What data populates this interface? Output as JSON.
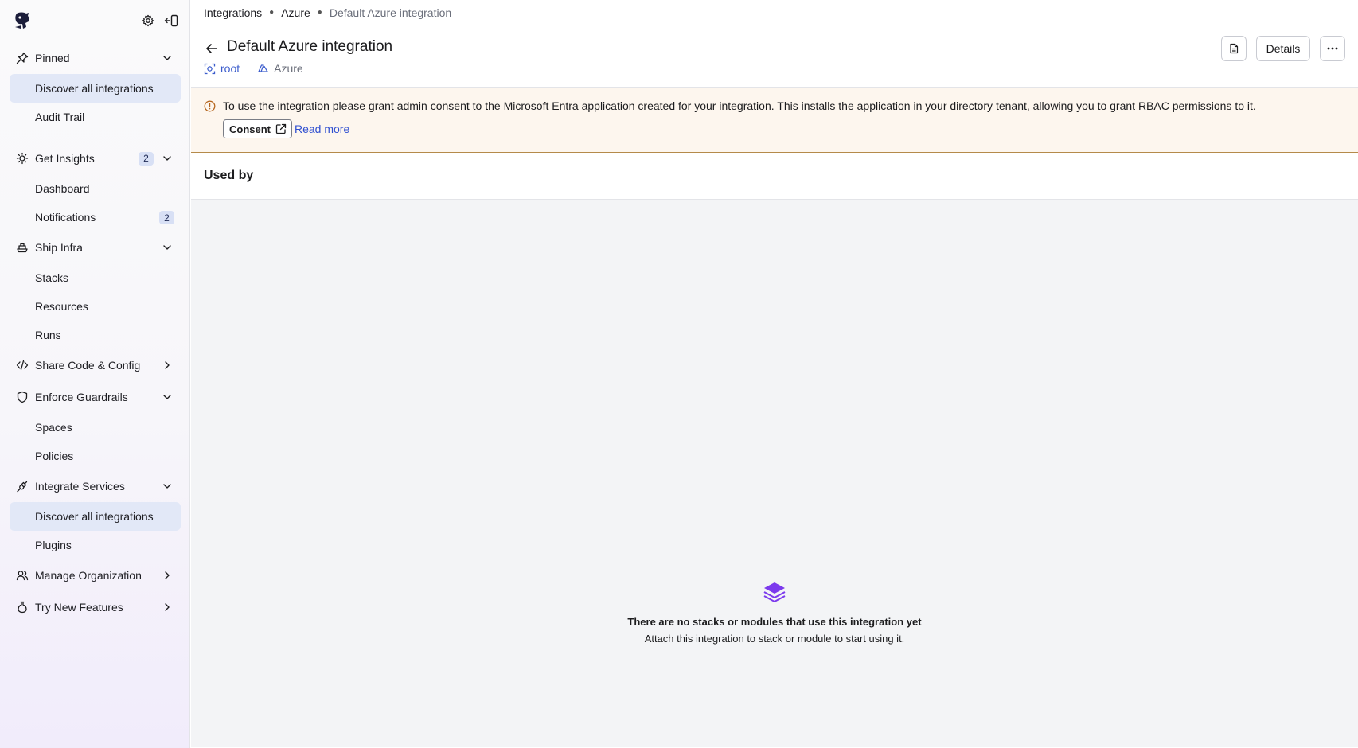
{
  "sidebar": {
    "pinned": {
      "label": "Pinned",
      "items": [
        {
          "label": "Discover all integrations",
          "active": true
        },
        {
          "label": "Audit Trail",
          "active": false
        }
      ]
    },
    "groups": [
      {
        "id": "get-insights",
        "label": "Get Insights",
        "icon": "lightbulb-icon",
        "badge": "2",
        "expanded": true,
        "items": [
          {
            "label": "Dashboard"
          },
          {
            "label": "Notifications",
            "badge": "2"
          }
        ]
      },
      {
        "id": "ship-infra",
        "label": "Ship Infra",
        "icon": "ship-icon",
        "expanded": true,
        "items": [
          {
            "label": "Stacks"
          },
          {
            "label": "Resources"
          },
          {
            "label": "Runs"
          }
        ]
      },
      {
        "id": "share-code",
        "label": "Share Code & Config",
        "icon": "code-icon",
        "expanded": false,
        "items": []
      },
      {
        "id": "enforce-guardrails",
        "label": "Enforce Guardrails",
        "icon": "shield-icon",
        "expanded": true,
        "items": [
          {
            "label": "Spaces"
          },
          {
            "label": "Policies"
          }
        ]
      },
      {
        "id": "integrate-services",
        "label": "Integrate Services",
        "icon": "plug-icon",
        "expanded": true,
        "items": [
          {
            "label": "Discover all integrations",
            "active": true
          },
          {
            "label": "Plugins"
          }
        ]
      },
      {
        "id": "manage-organization",
        "label": "Manage Organization",
        "icon": "users-icon",
        "expanded": false,
        "items": []
      },
      {
        "id": "try-new-features",
        "label": "Try New Features",
        "icon": "flask-icon",
        "expanded": false,
        "items": []
      }
    ]
  },
  "breadcrumb": {
    "items": [
      "Integrations",
      "Azure"
    ],
    "current": "Default Azure integration"
  },
  "header": {
    "title": "Default Azure integration",
    "space": "root",
    "provider": "Azure",
    "details_label": "Details"
  },
  "alert": {
    "text": "To use the integration please grant admin consent to the Microsoft Entra application created for your integration. This installs the application in your directory tenant, allowing you to grant RBAC permissions to it.",
    "consent_label": "Consent",
    "read_more_label": "Read more"
  },
  "used_by": {
    "title": "Used by",
    "empty_title": "There are no stacks or modules that use this integration yet",
    "empty_subtitle": "Attach this integration to stack or module to start using it."
  },
  "colors": {
    "accent": "#3b5ccc",
    "active_bg": "#e2e8f7",
    "alert_bg": "#fdf6ee",
    "alert_border": "#b58a4a",
    "empty_icon": "#7c3aed"
  }
}
